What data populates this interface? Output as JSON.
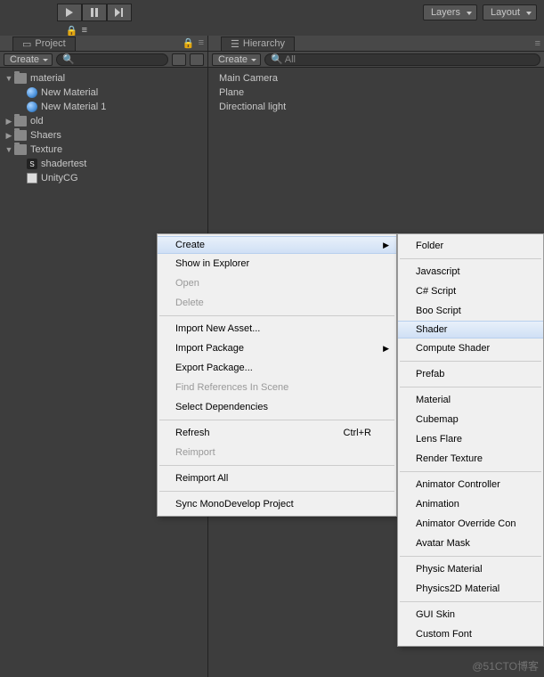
{
  "toolbar": {
    "layers_label": "Layers",
    "layout_label": "Layout"
  },
  "project": {
    "tab_label": "Project",
    "create_label": "Create",
    "search_placeholder": "",
    "tree": [
      {
        "label": "material",
        "type": "folder",
        "arrow": "open",
        "indent": 1
      },
      {
        "label": "New Material",
        "type": "mat",
        "arrow": "none",
        "indent": 2
      },
      {
        "label": "New Material 1",
        "type": "mat",
        "arrow": "none",
        "indent": 2
      },
      {
        "label": "old",
        "type": "folder",
        "arrow": "closed",
        "indent": 1
      },
      {
        "label": "Shaers",
        "type": "folder",
        "arrow": "closed",
        "indent": 1
      },
      {
        "label": "Texture",
        "type": "folder",
        "arrow": "open",
        "indent": 1
      },
      {
        "label": "shadertest",
        "type": "shader",
        "arrow": "none",
        "indent": 2
      },
      {
        "label": "UnityCG",
        "type": "cs",
        "arrow": "none",
        "indent": 2
      }
    ]
  },
  "hierarchy": {
    "tab_label": "Hierarchy",
    "create_label": "Create",
    "search_placeholder": "All",
    "items": [
      "Main Camera",
      "Plane",
      "Directional light"
    ]
  },
  "context_menu1": [
    {
      "label": "Create",
      "highlighted": true,
      "has_sub": true
    },
    {
      "label": "Show in Explorer"
    },
    {
      "label": "Open",
      "disabled": true
    },
    {
      "label": "Delete",
      "disabled": true
    },
    {
      "sep": true
    },
    {
      "label": "Import New Asset..."
    },
    {
      "label": "Import Package",
      "has_sub": true
    },
    {
      "label": "Export Package..."
    },
    {
      "label": "Find References In Scene",
      "disabled": true
    },
    {
      "label": "Select Dependencies"
    },
    {
      "sep": true
    },
    {
      "label": "Refresh",
      "shortcut": "Ctrl+R"
    },
    {
      "label": "Reimport",
      "disabled": true
    },
    {
      "sep": true
    },
    {
      "label": "Reimport All"
    },
    {
      "sep": true
    },
    {
      "label": "Sync MonoDevelop Project"
    }
  ],
  "context_menu2": [
    {
      "label": "Folder"
    },
    {
      "sep": true
    },
    {
      "label": "Javascript"
    },
    {
      "label": "C# Script"
    },
    {
      "label": "Boo Script"
    },
    {
      "label": "Shader",
      "highlighted": true
    },
    {
      "label": "Compute Shader"
    },
    {
      "sep": true
    },
    {
      "label": "Prefab"
    },
    {
      "sep": true
    },
    {
      "label": "Material"
    },
    {
      "label": "Cubemap"
    },
    {
      "label": "Lens Flare"
    },
    {
      "label": "Render Texture"
    },
    {
      "sep": true
    },
    {
      "label": "Animator Controller"
    },
    {
      "label": "Animation"
    },
    {
      "label": "Animator Override Con"
    },
    {
      "label": "Avatar Mask"
    },
    {
      "sep": true
    },
    {
      "label": "Physic Material"
    },
    {
      "label": "Physics2D Material"
    },
    {
      "sep": true
    },
    {
      "label": "GUI Skin"
    },
    {
      "label": "Custom Font"
    }
  ],
  "watermark": "@51CTO博客"
}
